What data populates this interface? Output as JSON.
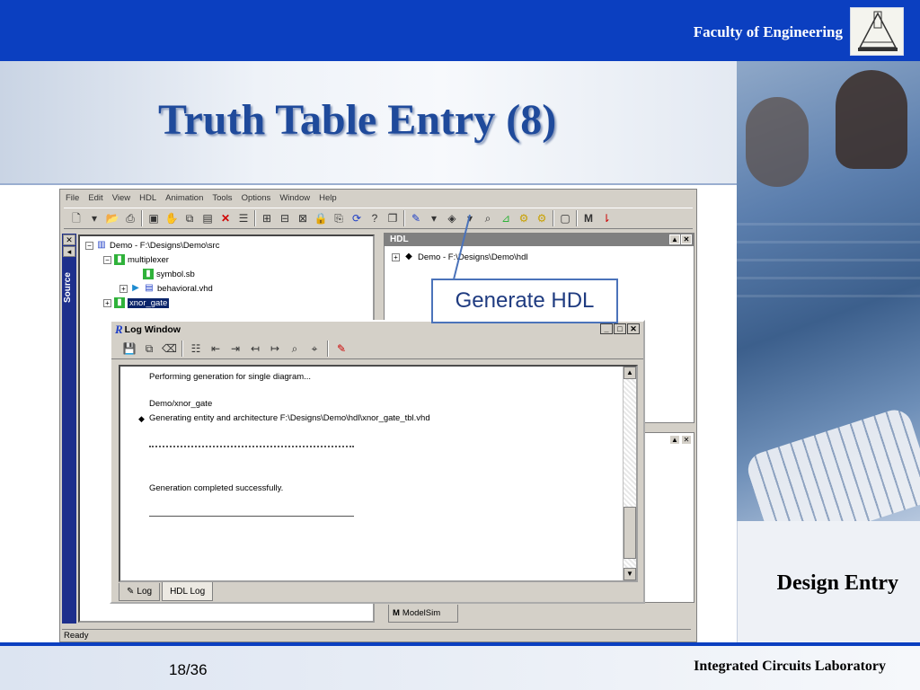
{
  "header": {
    "faculty": "Faculty of Engineering"
  },
  "slide": {
    "title": "Truth Table Entry (8)",
    "section": "Design Entry",
    "page": "18/36",
    "lab": "Integrated Circuits Laboratory"
  },
  "app": {
    "menu": [
      "File",
      "Edit",
      "View",
      "HDL",
      "Animation",
      "Tools",
      "Options",
      "Window",
      "Help"
    ],
    "status": "Ready",
    "source_panel": {
      "label": "Source",
      "tree": {
        "root": "Demo - F:\\Designs\\Demo\\src",
        "folder": "multiplexer",
        "file1": "symbol.sb",
        "file2": "behavioral.vhd",
        "selected": "xnor_gate"
      }
    },
    "hdl_panel": {
      "title": "HDL",
      "root": "Demo - F:\\Designs\\Demo\\hdl"
    },
    "modelsim_tab": "ModelSim"
  },
  "log_window": {
    "title": "Log Window",
    "lines": {
      "l1": "Performing generation for single diagram...",
      "l2": "Demo/xnor_gate",
      "l3": "Generating entity and architecture F:\\Designs\\Demo\\hdl\\xnor_gate_tbl.vhd",
      "l4": "Generation completed successfully."
    },
    "tabs": {
      "log": "Log",
      "hdl_log": "HDL Log"
    }
  },
  "callout": {
    "text": "Generate HDL"
  },
  "colors": {
    "brand_blue": "#0b3fc0",
    "title_blue": "#1f4a9b",
    "callout_border": "#4b73ba"
  }
}
